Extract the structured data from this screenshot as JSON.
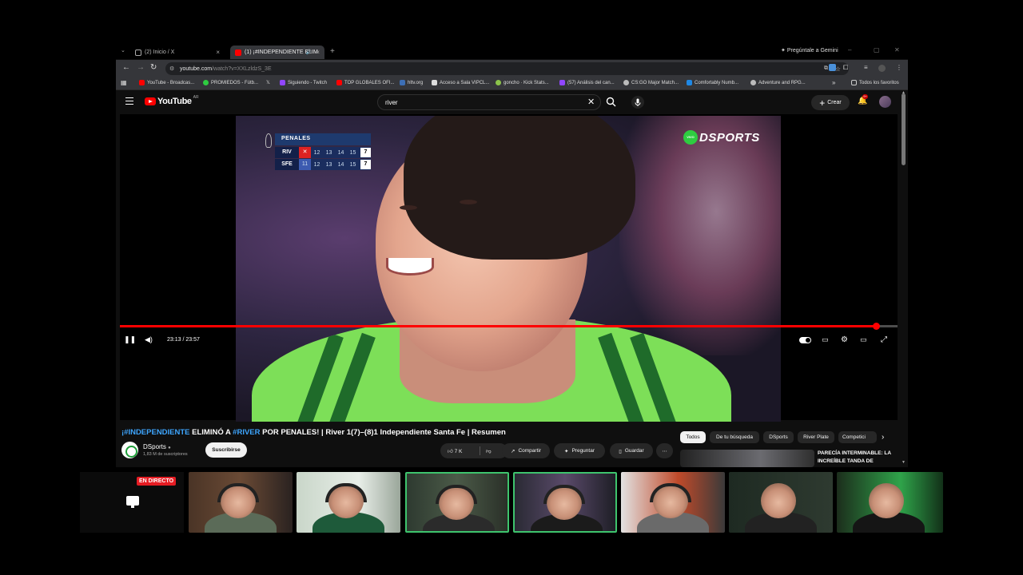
{
  "browser": {
    "tabs": [
      {
        "label": "(2) Inicio / X",
        "active": false
      },
      {
        "label": "(1) ¡#INDEPENDIENTE ELIM",
        "active": true
      }
    ],
    "gemini_label": "Pregúntale a Gemini",
    "url_host": "youtube.com",
    "url_path": "/watch?v=XXLzldzS_3E",
    "bookmarks": [
      "YouTube - Broadcas...",
      "PROMIEDOS - Fútb...",
      "Siguiendo - Twitch",
      "TOP GLOBALES OFI...",
      "hltv.org",
      "Acceso a Sala VIPCL...",
      "goncho · Kick Stats...",
      "(57) Análisis del can...",
      "CS:GO Major Match...",
      "Comfortably Numb...",
      "Adventure and RPG..."
    ],
    "all_bookmarks": "Todos los favoritos"
  },
  "youtube": {
    "logo_text": "YouTube",
    "country": "AR",
    "search_value": "river",
    "create_label": "Crear",
    "bell_badge": "9+"
  },
  "player": {
    "time": "23:13 / 23:57",
    "progress": 0.972,
    "scoreboard": {
      "title": "PENALES",
      "rows": [
        {
          "team": "RIV",
          "cells": [
            "✕",
            "12",
            "13",
            "14",
            "15"
          ],
          "total": "7"
        },
        {
          "team": "SFE",
          "cells": [
            "11",
            "12",
            "13",
            "14",
            "15"
          ],
          "total": "7"
        }
      ]
    },
    "broadcaster_badge": "VIVO",
    "broadcaster": "DSPORTS"
  },
  "video": {
    "title_hash1": "¡#INDEPENDIENTE",
    "title_mid": " ELIMINÓ A ",
    "title_hash2": "#RIVER",
    "title_rest": " POR PENALES! | River 1(7)–(8)1 Independiente Santa Fe | Resumen",
    "channel": "DSports",
    "subscribers": "1,83 M de suscriptores",
    "subscribe_label": "Suscribirse",
    "likes": "7 K",
    "share_label": "Compartir",
    "ask_label": "Preguntar",
    "save_label": "Guardar"
  },
  "chips": [
    "Todos",
    "De tu búsqueda",
    "DSports",
    "River Plate",
    "Competici"
  ],
  "recommended": {
    "title": "PARECÍA INTERMINABLE: LA INCREÍBLE TANDA DE"
  },
  "overlay": {
    "live_label": "EN DIRECTO"
  }
}
